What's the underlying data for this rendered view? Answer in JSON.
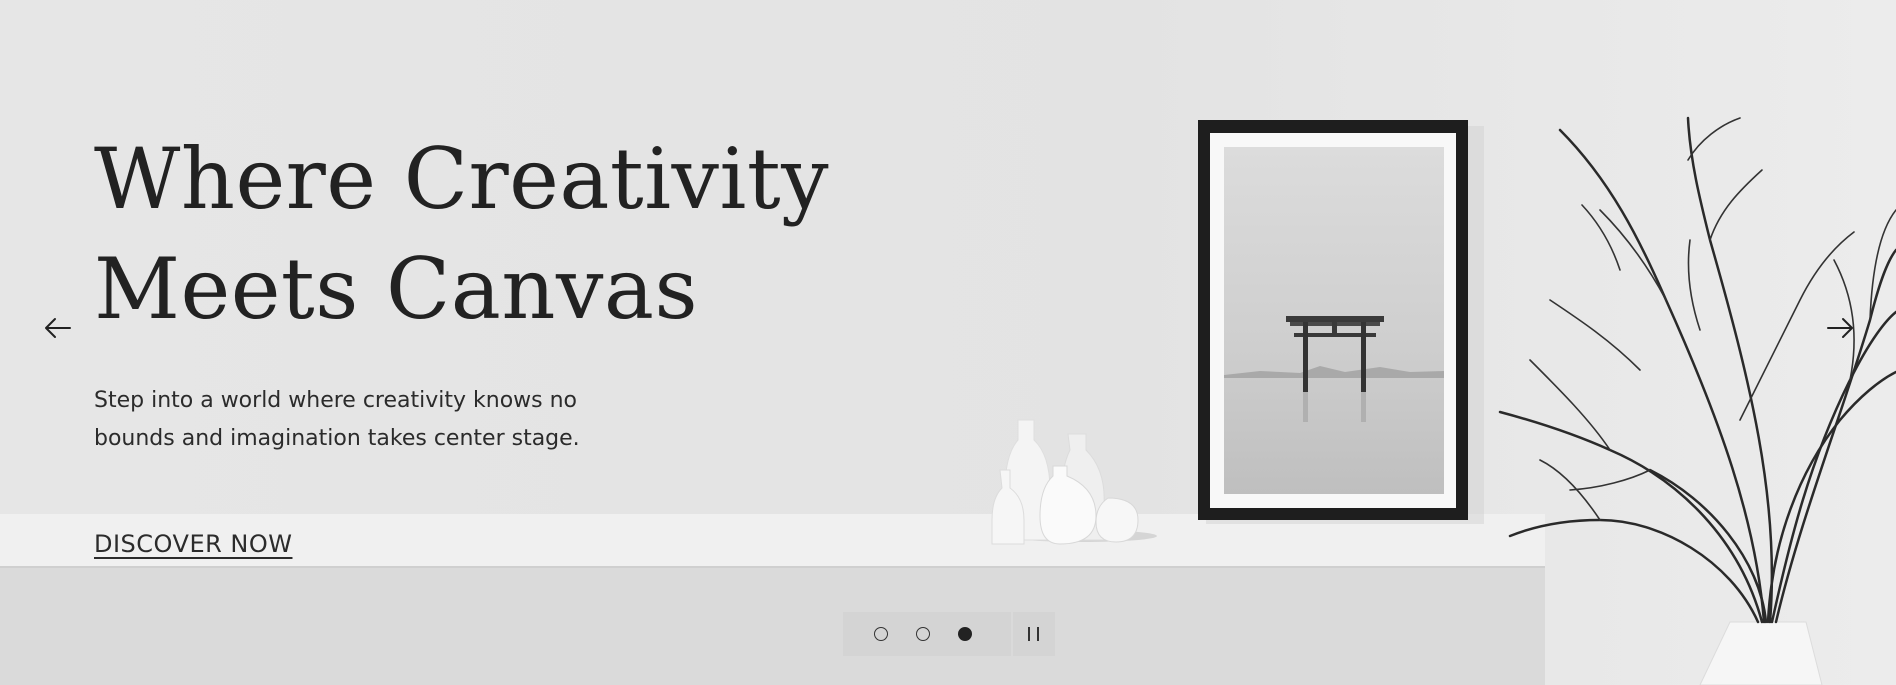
{
  "hero": {
    "title_line1": "Where Creativity",
    "title_line2": "Meets Canvas",
    "subtitle_line1": "Step into a world where creativity knows no",
    "subtitle_line2": "bounds and imagination takes center stage.",
    "cta_label": "DISCOVER NOW"
  },
  "slideshow": {
    "slide_count": 3,
    "active_slide": 3,
    "prev_icon": "arrow-left-icon",
    "next_icon": "arrow-right-icon",
    "pause_icon": "pause-icon"
  },
  "colors": {
    "background": "#e4e4e4",
    "text": "#222222",
    "shelf": "#f0f0f0",
    "frame": "#1e1e1e",
    "pager": "#d4d4d4"
  }
}
